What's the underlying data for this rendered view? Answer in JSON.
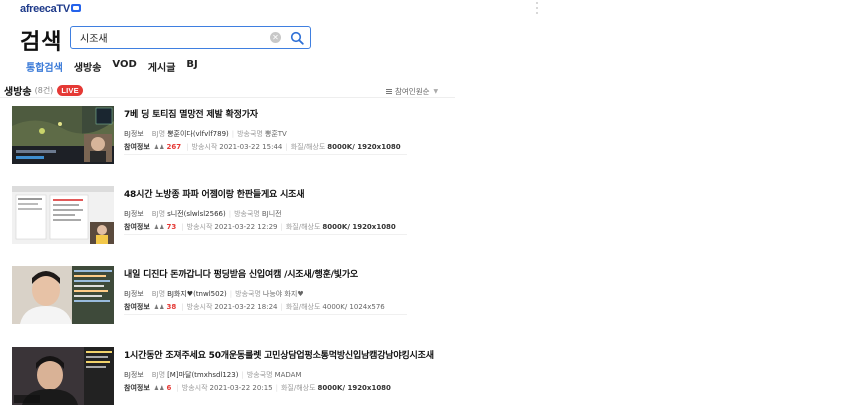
{
  "logo": {
    "text": "afreecaTV"
  },
  "page_title": "검색",
  "search": {
    "value": "시조새",
    "placeholder": ""
  },
  "tabs": [
    {
      "label": "통합검색",
      "active": true
    },
    {
      "label": "생방송",
      "active": false
    },
    {
      "label": "VOD",
      "active": false
    },
    {
      "label": "게시글",
      "active": false
    },
    {
      "label": "BJ",
      "active": false
    }
  ],
  "section": {
    "title": "생방송",
    "count": "(8건)",
    "badge": "LIVE",
    "sort_label": "참여인원순"
  },
  "labels": {
    "bj_info": "BJ정보",
    "bj_name": "BJ명",
    "broadcast_station": "방송국명",
    "participation": "참여정보",
    "start_time": "방송시작",
    "quality": "화질/해상도"
  },
  "streams": [
    {
      "title": "7베 딩 토티짐 멸망전 제발 확정가자",
      "bj": "뽕훈이다(vlfvlf789)",
      "station": "뽕훈TV",
      "viewers": "267",
      "start": "2021-03-22 15:44",
      "quality": "8000K/ 1920x1080",
      "quality_bold": true
    },
    {
      "title": "48시간 노방종 파파 어젬이랑 한판들게요 시조새",
      "bj": "s니전(slwlsl2566)",
      "station": "BJ니전",
      "viewers": "73",
      "start": "2021-03-22 12:29",
      "quality": "8000K/ 1920x1080",
      "quality_bold": true
    },
    {
      "title": "내일 디진다 돈까갑니다 펑딩받음 신입여캠 /시조새/행훈/빛가오",
      "bj": "BJ화지♥(tnwl502)",
      "station": "나능야 화지♥",
      "viewers": "38",
      "start": "2021-03-22 18:24",
      "quality": "4000K/ 1024x576",
      "quality_bold": false
    },
    {
      "title": "1시간동안 조져주세요 50개운동룰렛 고민상담업펑소통먹방신입남캠강남야킹시조새",
      "bj": "[M]마달(tmxhsdl123)",
      "station": "MADAM",
      "viewers": "6",
      "start": "2021-03-22 20:15",
      "quality": "8000K/ 1920x1080",
      "quality_bold": true
    }
  ],
  "colors": {
    "accent": "#3b7bd8",
    "live": "#e53935",
    "brand": "#1e3a8a"
  },
  "icons": {
    "search": "search-icon",
    "clear": "clear-icon",
    "sort": "sort-icon",
    "menu": "kebab-menu-icon",
    "viewers": "person-icon"
  }
}
